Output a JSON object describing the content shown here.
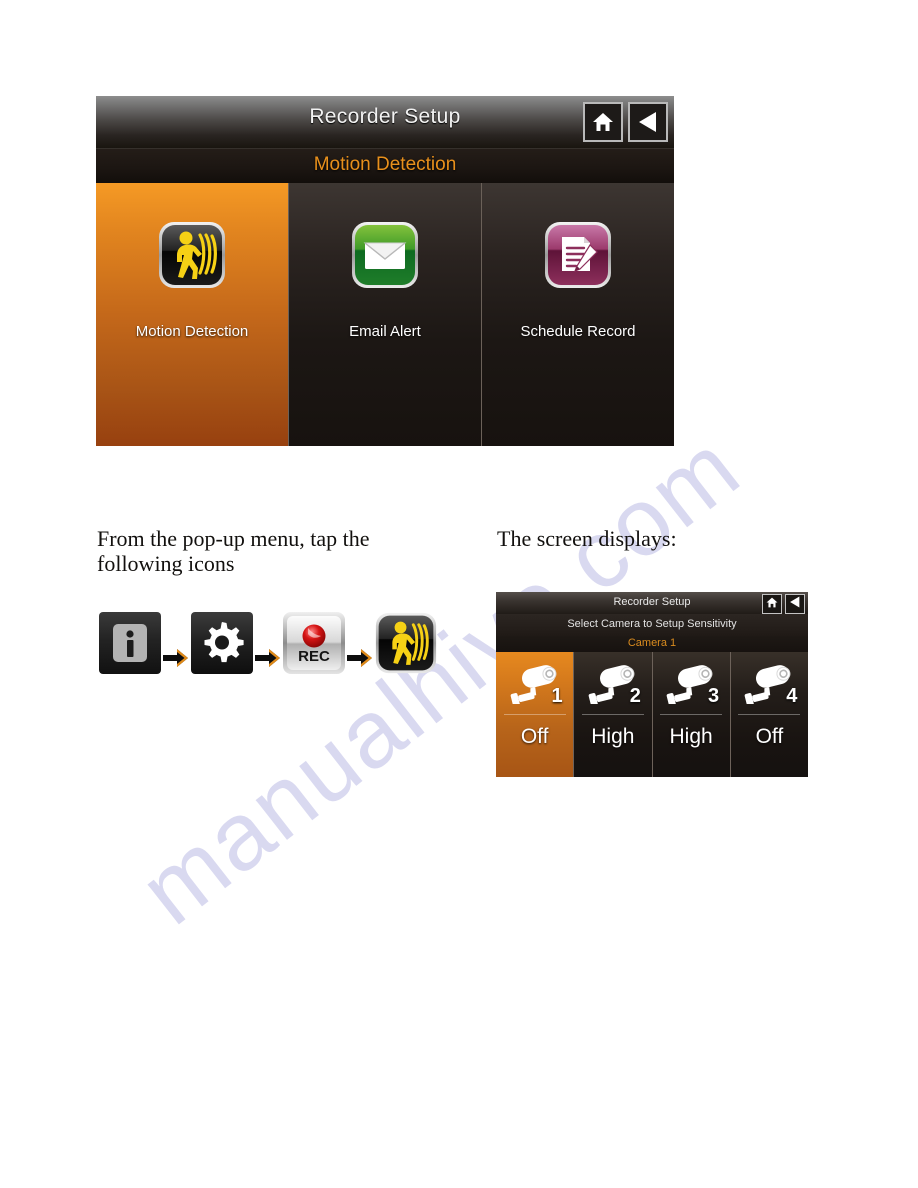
{
  "watermark": {
    "text": "manualhive.com"
  },
  "device_panel": {
    "title": "Recorder Setup",
    "subtitle": "Motion Detection",
    "nav": {
      "home_label": "home-button",
      "back_label": "back-button"
    },
    "tiles": [
      {
        "label": "Motion Detection",
        "icon": "motion-detection-icon",
        "selected": true,
        "color": "#E8901C"
      },
      {
        "label": "Email Alert",
        "icon": "email-alert-icon",
        "selected": false,
        "color": "#1E7B2E"
      },
      {
        "label": "Schedule Record",
        "icon": "schedule-record-icon",
        "selected": false,
        "color": "#8E2A5C"
      }
    ]
  },
  "instructions": {
    "left": "From the pop-up menu, tap the following icons",
    "right": "The screen displays:"
  },
  "icon_flow": {
    "steps": [
      {
        "icon": "info-icon"
      },
      {
        "icon": "gear-icon"
      },
      {
        "icon": "rec-icon",
        "label": "REC"
      },
      {
        "icon": "motion-detection-icon"
      }
    ],
    "arrow": "arrow-right-icon"
  },
  "mini_panel": {
    "title": "Recorder Setup",
    "subtitle_1": "Select Camera to Setup Sensitivity",
    "subtitle_2": "Camera 1",
    "cameras": [
      {
        "number": "1",
        "value": "Off",
        "selected": true
      },
      {
        "number": "2",
        "value": "High",
        "selected": false
      },
      {
        "number": "3",
        "value": "High",
        "selected": false
      },
      {
        "number": "4",
        "value": "Off",
        "selected": false
      }
    ]
  }
}
